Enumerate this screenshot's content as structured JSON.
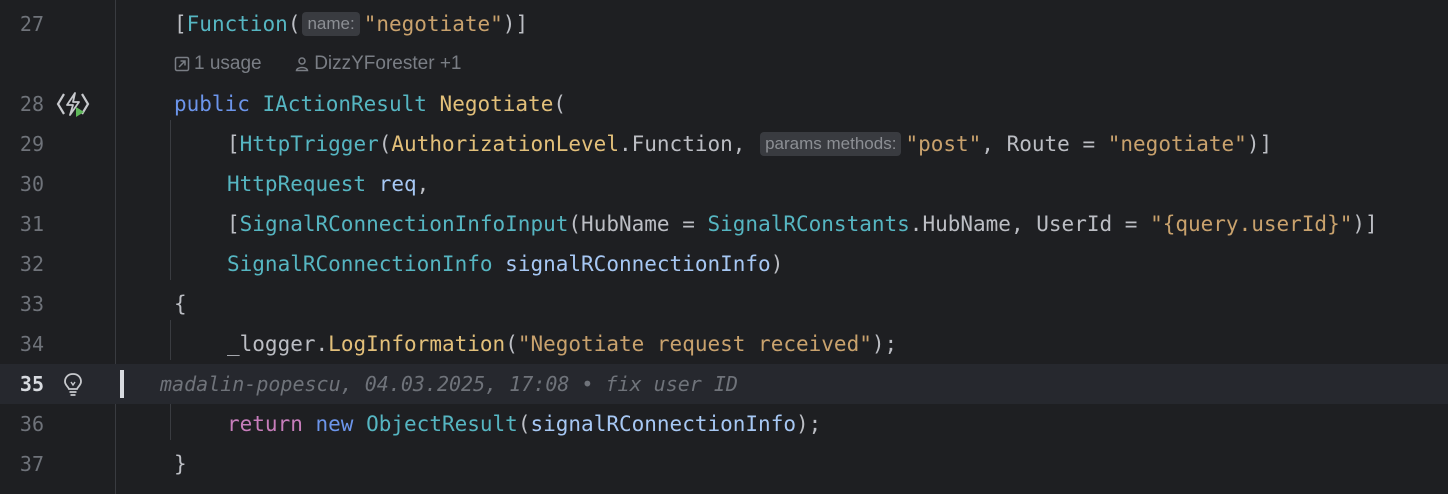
{
  "lines": {
    "l27": {
      "num": "27",
      "open_bracket": "[",
      "name": "Function",
      "paren": "(",
      "hint": "name:",
      "arg": "\"negotiate\"",
      "close": ")]"
    },
    "lens": {
      "usage": "1 usage",
      "author": "DizzYForester +1"
    },
    "l28": {
      "num": "28",
      "kw": "public",
      "type": "IActionResult",
      "method": "Negotiate",
      "paren": "("
    },
    "l29": {
      "num": "29",
      "bracket": "[",
      "attr": "HttpTrigger",
      "paren": "(",
      "enum_type": "AuthorizationLevel",
      "dot": ".",
      "enum_val": "Function",
      "comma": ",",
      "hint": "params methods:",
      "arg1": "\"post\"",
      "comma2": ", ",
      "route_name": "Route",
      "eq": " = ",
      "arg2": "\"negotiate\"",
      "close": ")]"
    },
    "l30": {
      "num": "30",
      "type": "HttpRequest",
      "param": "req",
      "comma": ","
    },
    "l31": {
      "num": "31",
      "bracket": "[",
      "attr": "SignalRConnectionInfoInput",
      "paren": "(",
      "p1": "HubName",
      "eq1": " = ",
      "ctype": "SignalRConstants",
      "dot": ".",
      "cval": "HubName",
      "comma": ", ",
      "p2": "UserId",
      "eq2": " = ",
      "str": "\"{query.userId}\"",
      "close": ")]"
    },
    "l32": {
      "num": "32",
      "type": "SignalRConnectionInfo",
      "param": "signalRConnectionInfo",
      "close": ")"
    },
    "l33": {
      "num": "33",
      "text": "{"
    },
    "l34": {
      "num": "34",
      "obj": "_logger",
      "dot": ".",
      "method": "LogInformation",
      "paren": "(",
      "str": "\"Negotiate request received\"",
      "close": ");"
    },
    "l35": {
      "num": "35",
      "blame": "madalin-popescu, 04.03.2025, 17:08 • fix user ID"
    },
    "l36": {
      "num": "36",
      "kw": "return",
      "kw2": "new",
      "type": "ObjectResult",
      "paren": "(",
      "arg": "signalRConnectionInfo",
      "close": ");"
    },
    "l37": {
      "num": "37",
      "text": "}"
    }
  },
  "icons": {
    "run": "azure-function-run-icon",
    "bulb": "lightbulb-icon",
    "usage": "external-link-icon",
    "author": "person-icon"
  },
  "colors": {
    "background": "#1e1f22",
    "current_line": "#26282e",
    "keyword": "#6c95eb",
    "string": "#c9a26d",
    "type": "#56b6c2"
  }
}
